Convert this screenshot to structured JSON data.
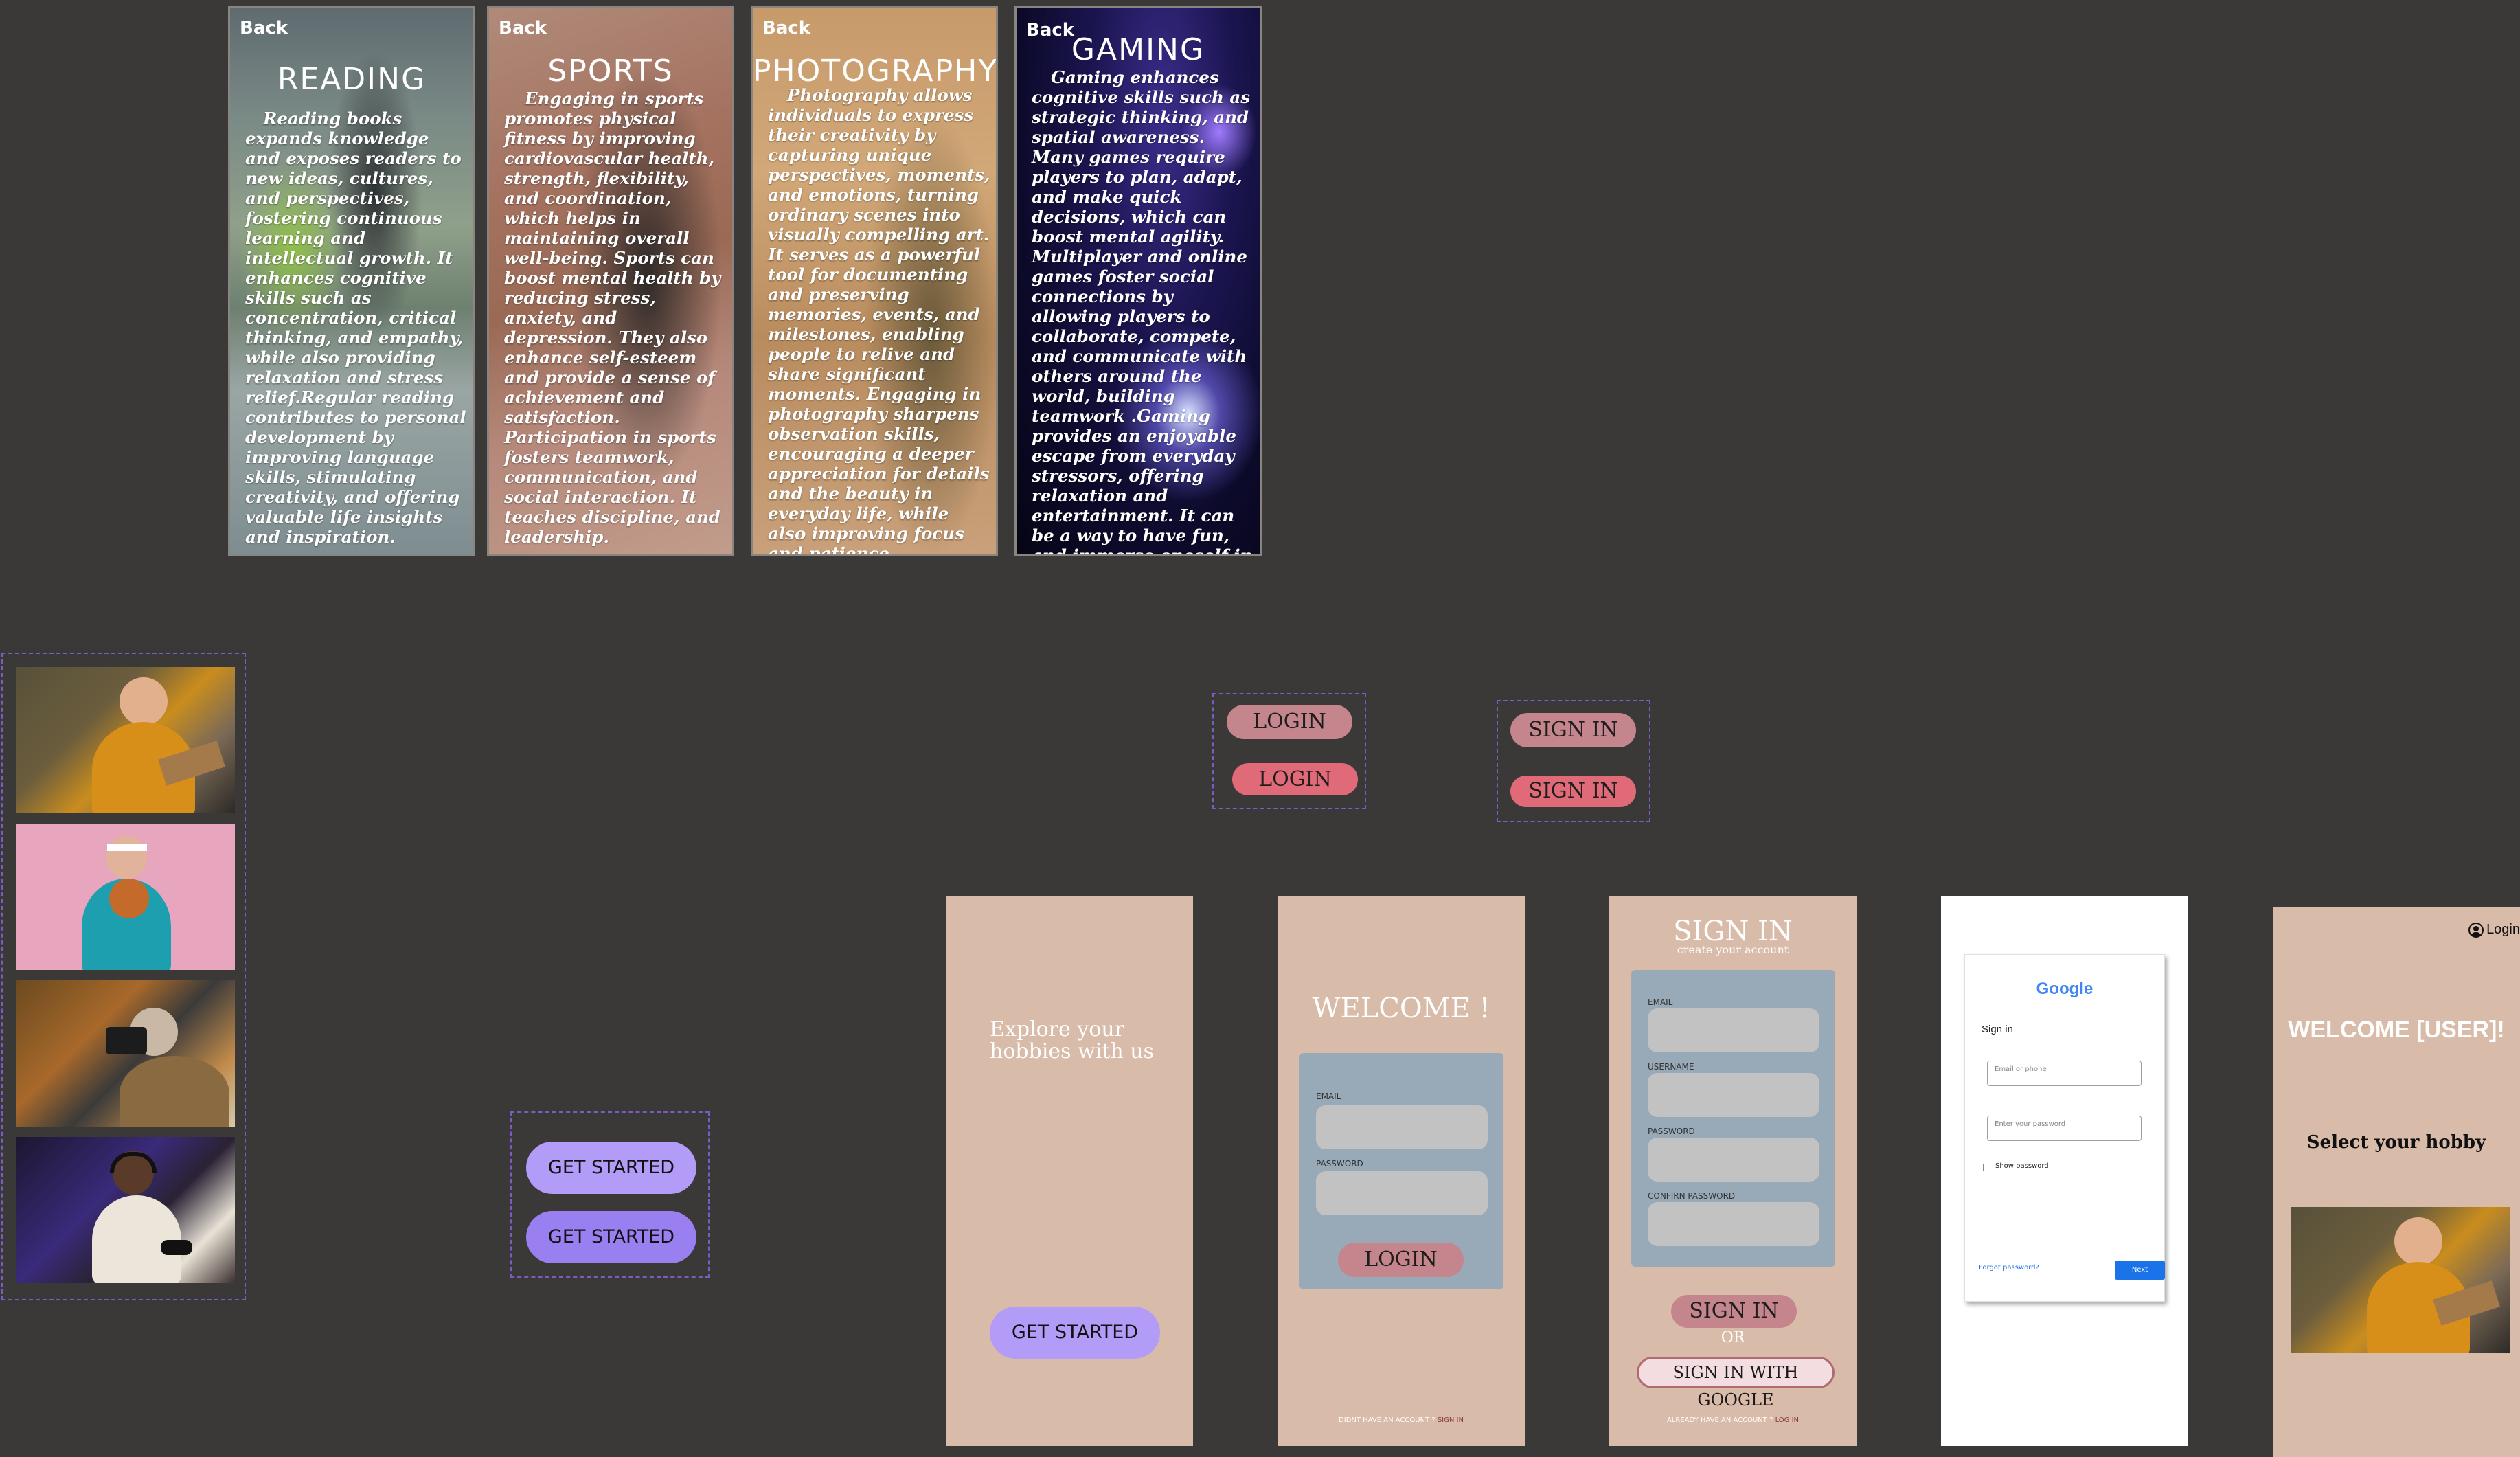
{
  "cards": [
    {
      "back": "Back",
      "title": "READING",
      "text": "Reading books expands knowledge and exposes readers to new ideas, cultures, and perspectives, fostering continuous learning and intellectual growth. It enhances cognitive skills such as concentration, critical thinking, and empathy, while also providing relaxation and stress relief.Regular reading contributes to personal development by improving language skills, stimulating creativity, and offering valuable life insights and inspiration."
    },
    {
      "back": "Back",
      "title": "SPORTS",
      "text": "Engaging in sports promotes physical fitness by improving cardiovascular health, strength, flexibility, and coordination, which helps in maintaining overall well-being. Sports can boost mental health by reducing stress, anxiety, and depression. They also enhance self-esteem and provide a sense of achievement and satisfaction. Participation in sports fosters teamwork, communication, and social interaction. It teaches discipline, and leadership."
    },
    {
      "back": "Back",
      "title": "PHOTOGRAPHY",
      "text": "Photography allows individuals to express their creativity by capturing unique perspectives, moments, and emotions, turning ordinary scenes into visually compelling art. It serves as a powerful tool for documenting and preserving memories, events, and milestones, enabling people to relive and share significant moments. Engaging in photography sharpens observation skills, encouraging a deeper appreciation for details and the beauty in everyday life, while also improving focus and patience."
    },
    {
      "back": "Back",
      "title": "GAMING",
      "text": "Gaming enhances cognitive skills such as strategic thinking, and spatial awareness. Many games require players to plan, adapt, and make quick decisions, which can boost mental agility. Multiplayer and online games foster social connections by allowing players to collaborate, compete, and communicate with others around the world, building teamwork .Gaming provides an enjoyable escape from everyday stressors, offering relaxation and entertainment. It can be a way to have fun, and immerse oneself in different virtual worlds."
    }
  ],
  "components": {
    "login_a": "LOGIN",
    "login_b": "LOGIN",
    "signin_a": "SIGN IN",
    "signin_b": "SIGN IN",
    "get_started_a": "GET STARTED",
    "get_started_b": "GET STARTED"
  },
  "screen_landing": {
    "headline": "Explore your hobbies with us",
    "button": "GET STARTED"
  },
  "screen_login": {
    "title": "WELCOME !",
    "email_label": "EMAIL",
    "password_label": "PASSWORD",
    "button": "LOGIN",
    "footer_text": "DIDNT HAVE AN ACCOUNT ?",
    "footer_link": "SIGN IN"
  },
  "screen_signin": {
    "title": "SIGN IN",
    "subtitle": "create your account",
    "email_label": "EMAIL",
    "username_label": "USERNAME",
    "password_label": "PASSWORD",
    "confirm_label": "CONFIRN PASSWORD",
    "button": "SIGN IN",
    "or": "OR",
    "google_button": "SIGN IN WITH GOOGLE",
    "footer_text": "ALREADY HAVE AN ACCOUNT ?",
    "footer_link": "LOG IN"
  },
  "screen_google": {
    "logo": "Google",
    "heading": "Sign in",
    "email_placeholder": "Email or phone",
    "password_placeholder": "Enter your password",
    "show_password": "Show password",
    "forgot": "Forgot password?",
    "next": "Next"
  },
  "screen_welcome": {
    "login": "Login",
    "title": "WELCOME [USER]!",
    "subtitle": "Select your hobby"
  },
  "colors": {
    "background": "#3a3938",
    "screen_bg": "#d9bba9",
    "form_panel": "#98a9b8",
    "pill_muted": "#c5858c",
    "pill_bright": "#e06a77",
    "get_started_light": "#b39cf8",
    "get_started_dark": "#9a7ff0",
    "dashed_border": "#7c5cc4",
    "google_next": "#1a73e8"
  }
}
